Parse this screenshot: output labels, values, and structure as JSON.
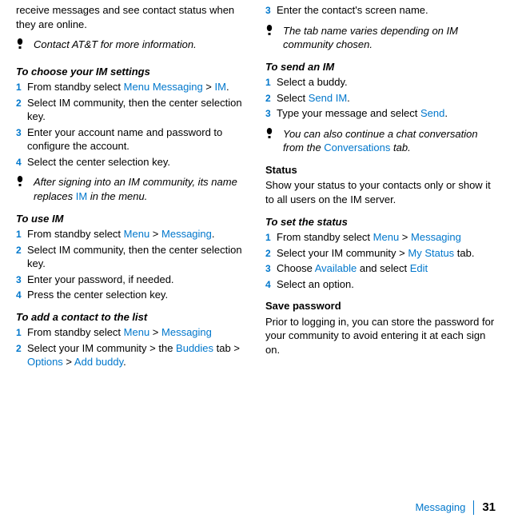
{
  "left": {
    "intro": "receive messages and see contact status when they are online.",
    "note1": "Contact AT&T for more information.",
    "h_choose": "To choose your IM settings",
    "choose": [
      {
        "n": "1",
        "pre": "From standby select ",
        "blue1": "Menu",
        "mid": " ",
        "blue2": "Messaging",
        "mid2": " > ",
        "blue3": "IM",
        "post": "."
      },
      {
        "n": "2",
        "plain": "Select IM community, then the center selection key."
      },
      {
        "n": "3",
        "plain": "Enter your account name and password to configure the account."
      },
      {
        "n": "4",
        "plain": "Select the center selection key."
      }
    ],
    "note2_pre": "After signing into an IM community, its name replaces ",
    "note2_blue": "IM",
    "note2_post": " in the menu.",
    "h_use": "To use IM",
    "use": [
      {
        "n": "1",
        "pre": "From standby select ",
        "blue1": "Menu",
        "mid": " > ",
        "blue2": "Messaging",
        "post": "."
      },
      {
        "n": "2",
        "plain": "Select IM community, then the center selection key."
      },
      {
        "n": "3",
        "plain": "Enter your password, if needed."
      },
      {
        "n": "4",
        "plain": "Press the center selection key."
      }
    ],
    "h_add": "To add a contact to the list",
    "add": [
      {
        "n": "1",
        "pre": "From standby select ",
        "blue1": "Menu",
        "mid": " > ",
        "blue2": "Messaging",
        "post": ""
      },
      {
        "n": "2",
        "pre": "Select your IM community > the ",
        "blue1": "Buddies",
        "mid": " tab > ",
        "blue2": "Options",
        "mid2": " > ",
        "blue3": "Add buddy",
        "post": "."
      }
    ]
  },
  "right": {
    "add3": {
      "n": "3",
      "plain": "Enter the contact's screen name."
    },
    "note_tab": "The tab name varies depending on IM community chosen.",
    "h_send": "To send an IM",
    "send": [
      {
        "n": "1",
        "plain": "Select a buddy."
      },
      {
        "n": "2",
        "pre": "Select ",
        "blue1": "Send IM",
        "post": "."
      },
      {
        "n": "3",
        "pre": "Type your message and select ",
        "blue1": "Send",
        "post": "."
      }
    ],
    "note_conv_pre": "You can also continue a chat conversation from the ",
    "note_conv_blue": "Conversations",
    "note_conv_post": " tab.",
    "h_status": "Status",
    "status_desc": "Show your status to your contacts only or show it to all users on the IM server.",
    "h_setstatus": "To set the status",
    "setstatus": [
      {
        "n": "1",
        "pre": "From standby select ",
        "blue1": "Menu",
        "mid": " > ",
        "blue2": "Messaging",
        "post": ""
      },
      {
        "n": "2",
        "pre": "Select your IM community > ",
        "blue1": "My Status",
        "post": " tab."
      },
      {
        "n": "3",
        "pre": "Choose ",
        "blue1": "Available",
        "mid": " and select ",
        "blue2": "Edit",
        "post": ""
      },
      {
        "n": "4",
        "plain": "Select an option."
      }
    ],
    "h_savepw": "Save password",
    "savepw_desc": "Prior to logging in, you can store the password for your community to avoid entering it at each sign on."
  },
  "footer": {
    "section": "Messaging",
    "page": "31"
  }
}
